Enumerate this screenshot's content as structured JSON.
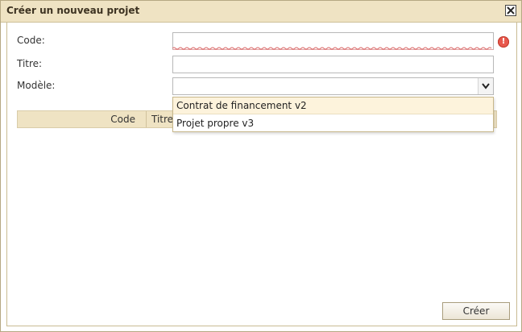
{
  "dialog": {
    "title": "Créer un nouveau projet",
    "close_icon": "close-icon"
  },
  "form": {
    "code_label": "Code:",
    "code_value": "",
    "code_error_icon": "error-icon",
    "titre_label": "Titre:",
    "titre_value": "",
    "modele_label": "Modèle:",
    "modele_value": "",
    "modele_arrow_icon": "chevron-down-icon",
    "modele_options": [
      "Contrat de financement v2",
      "Projet propre v3"
    ]
  },
  "grid": {
    "columns": [
      "Code",
      "Titre"
    ]
  },
  "actions": {
    "create_label": "Créer"
  },
  "colors": {
    "titlebar": "#efe3c3",
    "error": "#e8584d",
    "highlight": "#fdf3dc"
  }
}
